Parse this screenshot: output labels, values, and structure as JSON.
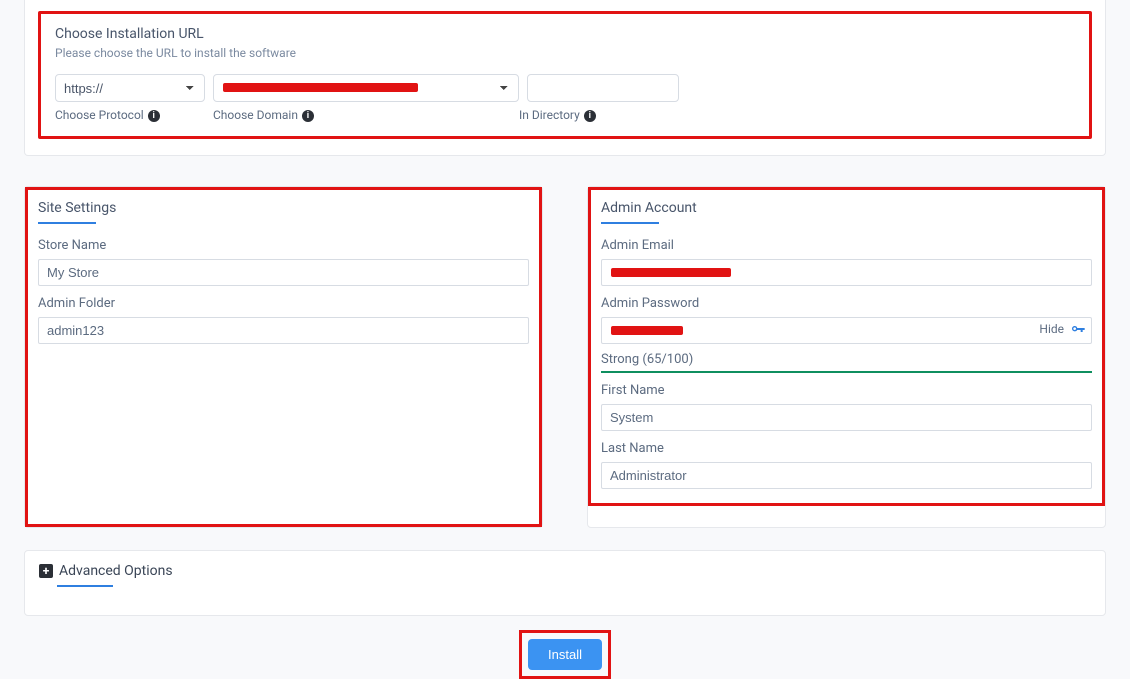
{
  "installUrl": {
    "title": "Choose Installation URL",
    "subtitle": "Please choose the URL to install the software",
    "protocol": {
      "label": "Choose Protocol",
      "value": "https://"
    },
    "domain": {
      "label": "Choose Domain",
      "value": ""
    },
    "directory": {
      "label": "In Directory",
      "value": ""
    }
  },
  "siteSettings": {
    "title": "Site Settings",
    "storeName": {
      "label": "Store Name",
      "value": "My Store"
    },
    "adminFolder": {
      "label": "Admin Folder",
      "value": "admin123"
    }
  },
  "adminAccount": {
    "title": "Admin Account",
    "email": {
      "label": "Admin Email",
      "value": ""
    },
    "password": {
      "label": "Admin Password",
      "value": "",
      "hideText": "Hide"
    },
    "strength": {
      "text": "Strong (65/100)"
    },
    "firstName": {
      "label": "First Name",
      "value": "System"
    },
    "lastName": {
      "label": "Last Name",
      "value": "Administrator"
    }
  },
  "advanced": {
    "label": "Advanced Options"
  },
  "install": {
    "label": "Install"
  }
}
